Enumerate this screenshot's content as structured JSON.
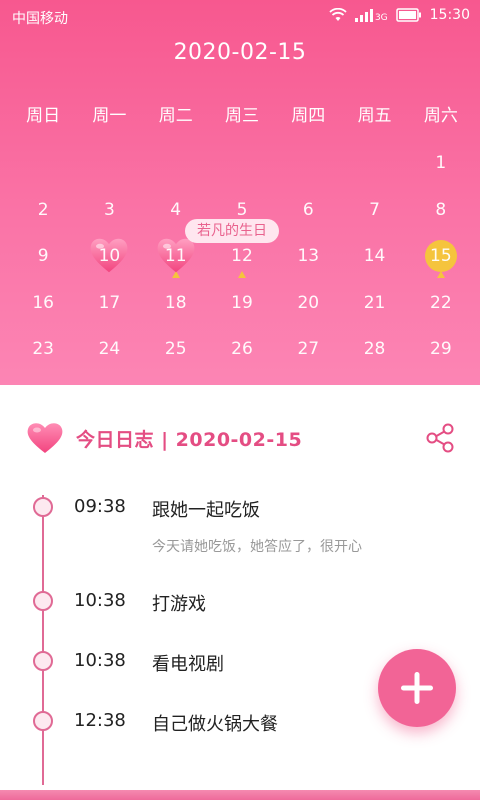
{
  "status": {
    "carrier": "中国移动",
    "network": "3G",
    "time": "15:30"
  },
  "calendar": {
    "title": "2020-02-15",
    "weekdays": [
      "周日",
      "周一",
      "周二",
      "周三",
      "周四",
      "周五",
      "周六"
    ],
    "weeks": [
      [
        "",
        "",
        "",
        "",
        "",
        "",
        "1"
      ],
      [
        "2",
        "3",
        "4",
        "5",
        "6",
        "7",
        "8"
      ],
      [
        "9",
        "10",
        "11",
        "12",
        "13",
        "14",
        "15"
      ],
      [
        "16",
        "17",
        "18",
        "19",
        "20",
        "21",
        "22"
      ],
      [
        "23",
        "24",
        "25",
        "26",
        "27",
        "28",
        "29"
      ]
    ],
    "heart_days": [
      "10",
      "11"
    ],
    "today": "15",
    "marker_days": [
      "11",
      "12",
      "15"
    ],
    "event_tag": "若凡的生日",
    "colors": {
      "accent": "#f7588f",
      "today": "#f5c43d"
    }
  },
  "log": {
    "title": "今日日志 | 2020-02-15",
    "items": [
      {
        "time": "09:38",
        "text": "跟她一起吃饭",
        "sub": "今天请她吃饭，她答应了，很开心"
      },
      {
        "time": "10:38",
        "text": "打游戏"
      },
      {
        "time": "10:38",
        "text": "看电视剧"
      },
      {
        "time": "12:38",
        "text": "自己做火锅大餐"
      }
    ]
  },
  "icons": {
    "share": "share-icon",
    "add": "plus-icon",
    "log_heart": "heart-icon"
  }
}
